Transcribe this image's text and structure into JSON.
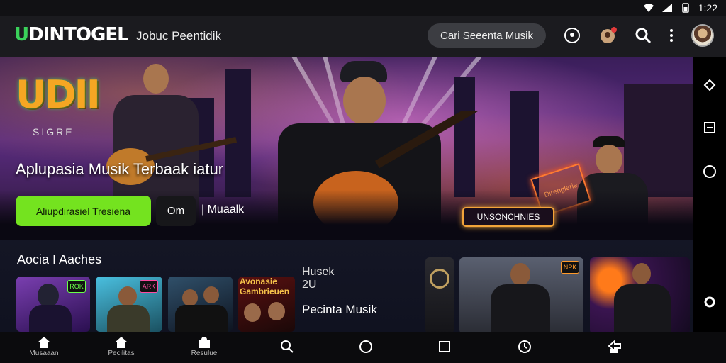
{
  "status_bar": {
    "time": "1:22"
  },
  "header": {
    "logo_accent": "U",
    "logo_rest": "DINTOGEL",
    "title": "Jobuc Peentidik",
    "search_label": "Cari Seeenta Musik",
    "icons": [
      "location-pin-icon",
      "notification-avatar-icon",
      "search-icon",
      "more-vert-icon"
    ]
  },
  "hero": {
    "logo_text": "UDII",
    "logo_sub": "SIGRE",
    "title": "Aplupasia Musik Terbaak iatur",
    "primary_button": "Aliupdirasiel Tresiena",
    "secondary_button": "Om",
    "link_text": "| Muaalk",
    "neon_sign": "UNSONCHNIES",
    "neon_tag": "Direnglerie"
  },
  "section": {
    "title": "Aocia I Aaches",
    "album_text": "Avonasie Gambrieuen",
    "feature_title_line1": "Husek",
    "feature_title_line2": "2U",
    "feature_subtitle": "Pecinta Musik",
    "thumb_badges": [
      "ROK",
      "ARK",
      "",
      "",
      "",
      "",
      "NPK",
      ""
    ]
  },
  "bottom_nav": {
    "items": [
      "Musaaan",
      "Pecilitas",
      "Resulue"
    ]
  },
  "colors": {
    "accent_green": "#74e31f",
    "logo_green": "#3ad15a",
    "header_bg": "#1b1b1f",
    "neon_orange": "#f3a43a"
  }
}
